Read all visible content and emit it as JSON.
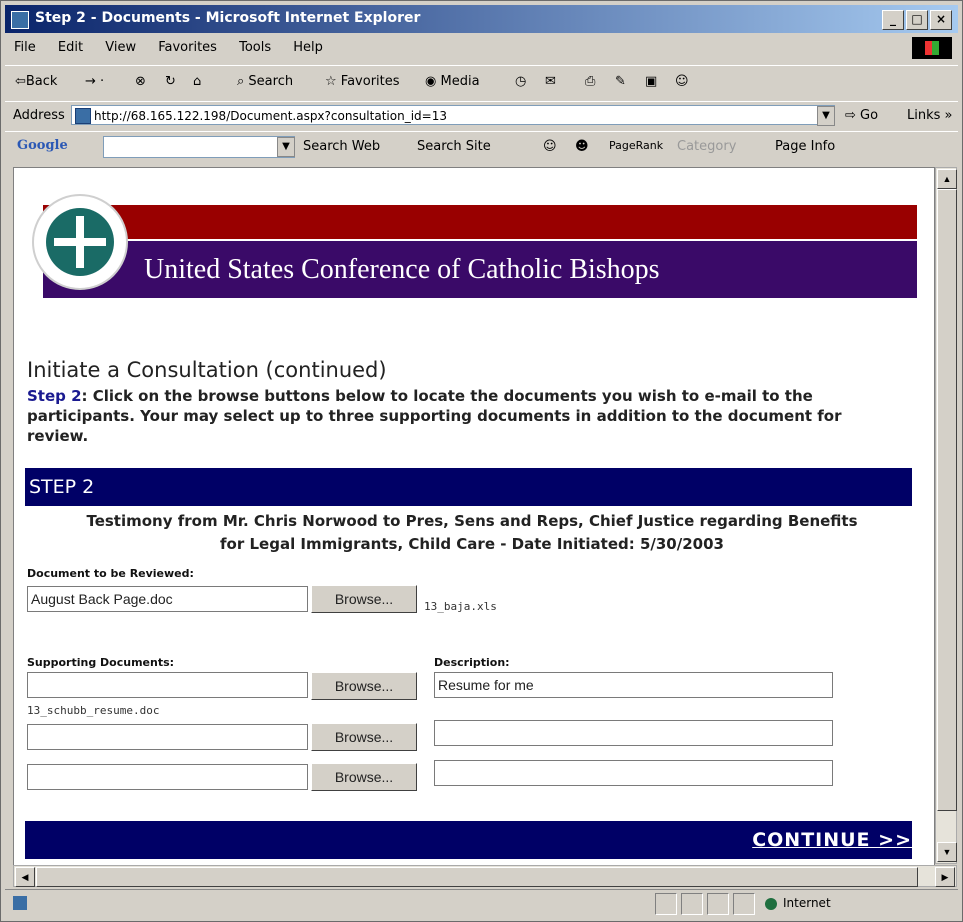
{
  "window": {
    "title": "Step 2 - Documents - Microsoft Internet Explorer",
    "controls": [
      "_",
      "□",
      "×"
    ]
  },
  "menu": [
    "File",
    "Edit",
    "View",
    "Favorites",
    "Tools",
    "Help"
  ],
  "toolbar": {
    "back": "⇦Back",
    "search": "Search",
    "favorites": "Favorites",
    "media": "Media"
  },
  "address": {
    "label": "Address",
    "url": "http://68.165.122.198/Document.aspx?consultation_id=13",
    "go": "Go",
    "links": "Links »"
  },
  "google": {
    "logo": "Google",
    "search_web": "Search Web",
    "search_site": "Search Site",
    "pagerank": "PageRank",
    "category": "Category",
    "page_info": "Page Info"
  },
  "page": {
    "org_title": "United States Conference of Catholic Bishops",
    "heading": "Initiate a Consultation (continued)",
    "step_label": "Step 2",
    "intro_text": ": Click on the browse buttons below to locate the documents you wish to e-mail to the participants. Your may select up to three supporting documents in addition to the document for review.",
    "step_bar": "STEP 2",
    "testimony_line1": "Testimony from Mr. Chris Norwood to Pres, Sens and Reps, Chief Justice regarding Benefits",
    "testimony_line2": "for Legal Immigrants, Child Care - Date Initiated: 5/30/2003",
    "review_label": "Document to be Reviewed:",
    "review_value": "August Back Page.doc",
    "review_file": "13_baja.xls",
    "browse_label": "Browse...",
    "supporting_label": "Supporting Documents:",
    "description_label": "Description:",
    "supporting": [
      {
        "value": "",
        "description": "Resume for me",
        "file": "13_schubb_resume.doc"
      },
      {
        "value": "",
        "description": "",
        "file": ""
      },
      {
        "value": "",
        "description": "",
        "file": ""
      }
    ],
    "continue": "CONTINUE >>"
  },
  "status": {
    "zone": "Internet"
  }
}
